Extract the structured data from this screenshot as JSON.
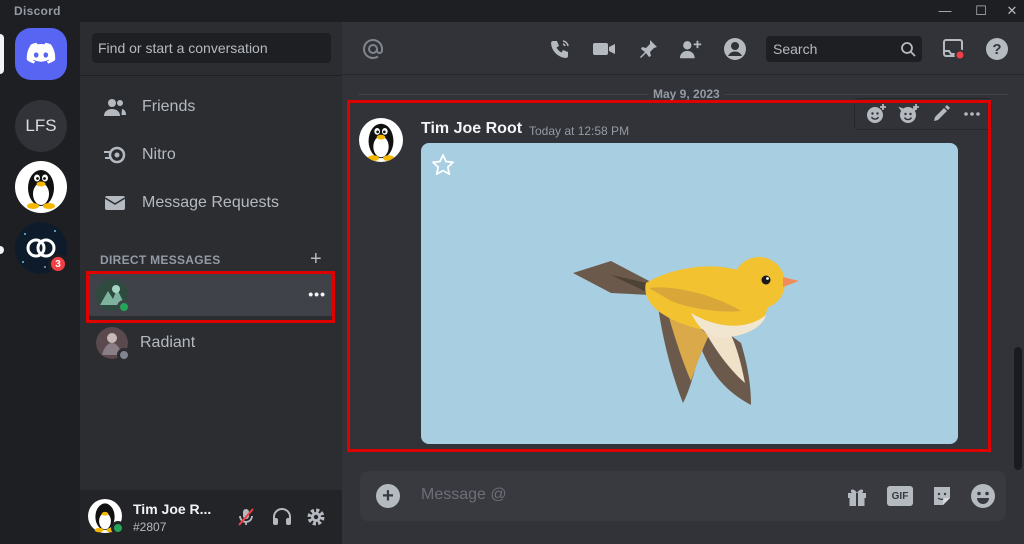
{
  "titlebar": {
    "brand": "Discord",
    "minimize": "—",
    "maximize": "☐",
    "close": "✕"
  },
  "servers": {
    "lfs_label": "LFS",
    "space_badge": "3"
  },
  "sidebar": {
    "search_placeholder": "Find or start a conversation",
    "nav": [
      {
        "label": "Friends",
        "icon": "friends-icon"
      },
      {
        "label": "Nitro",
        "icon": "nitro-icon"
      },
      {
        "label": "Message Requests",
        "icon": "envelope-icon"
      }
    ],
    "dm_header": "DIRECT MESSAGES",
    "dm_add": "+",
    "dms": [
      {
        "name": "",
        "status": "online",
        "more": "•••"
      },
      {
        "name": "Radiant",
        "status": "offline"
      }
    ]
  },
  "user_panel": {
    "name": "Tim Joe R...",
    "tag": "#2807"
  },
  "header": {
    "search_placeholder": "Search",
    "icons": [
      "at-icon",
      "voice-call-icon",
      "video-call-icon",
      "pin-icon",
      "add-friend-icon",
      "user-profile-icon",
      "search-icon",
      "inbox-icon",
      "help-icon"
    ]
  },
  "chat": {
    "date_divider": "May 9, 2023",
    "message": {
      "author": "Tim Joe Root",
      "timestamp": "Today at 12:58 PM",
      "attachment": "bird-image"
    },
    "hover_actions": [
      "add-reaction-icon",
      "add-super-reaction-icon",
      "edit-icon",
      "more-icon"
    ]
  },
  "composer": {
    "placeholder": "Message @",
    "buttons": [
      "gift-icon",
      "gif-button",
      "sticker-icon",
      "emoji-icon"
    ],
    "gif_label": "GIF"
  },
  "colors": {
    "accent": "#5865f2",
    "online": "#23a55a",
    "highlight_box": "#e00000",
    "badge": "#f23f43"
  }
}
